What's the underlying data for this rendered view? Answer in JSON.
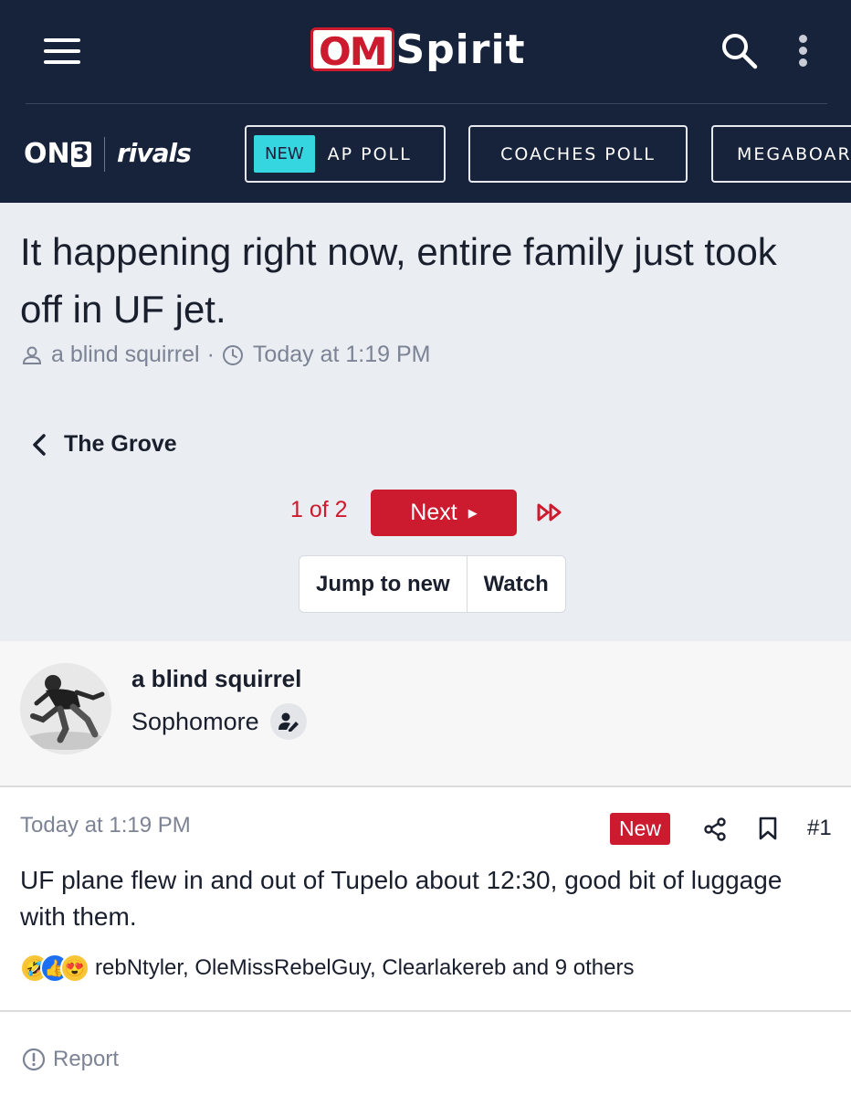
{
  "header": {
    "logo_om": "OM",
    "logo_spirit": "Spirit",
    "menu_icon": "hamburger-icon",
    "search_icon": "search-icon",
    "more_icon": "kebab-icon"
  },
  "brand_bar": {
    "on3_text": "ON",
    "on3_three": "3",
    "rivals_text": "rivals",
    "nav": [
      {
        "badge": "NEW",
        "label": "AP POLL"
      },
      {
        "label": "COACHES POLL"
      },
      {
        "label": "MEGABOARD"
      }
    ],
    "badge_color": "#35d6e0"
  },
  "thread": {
    "title": "It happening right now, entire family just took off in UF jet.",
    "author": "a blind squirrel",
    "separator": "·",
    "time": "Today at 1:19 PM",
    "forum": "The Grove",
    "page_status": "1 of 2",
    "next_label": "Next",
    "jump_label": "Jump to new",
    "watch_label": "Watch"
  },
  "post": {
    "author": "a blind squirrel",
    "rank": "Sophomore",
    "time": "Today at 1:19 PM",
    "new_tag": "New",
    "number": "#1",
    "body": "UF plane flew in and out of Tupelo about 12:30, good bit of luggage with them.",
    "reactions": [
      "rolling-laughing-icon",
      "thumbs-up-icon",
      "heart-eyes-icon"
    ],
    "reaction_text": "rebNtyler, OleMissRebelGuy, Clearlakereb and 9 others",
    "report_label": "Report"
  },
  "colors": {
    "navy": "#17223b",
    "accent_red": "#cc1a2e",
    "background_gray": "#eaedf1"
  }
}
